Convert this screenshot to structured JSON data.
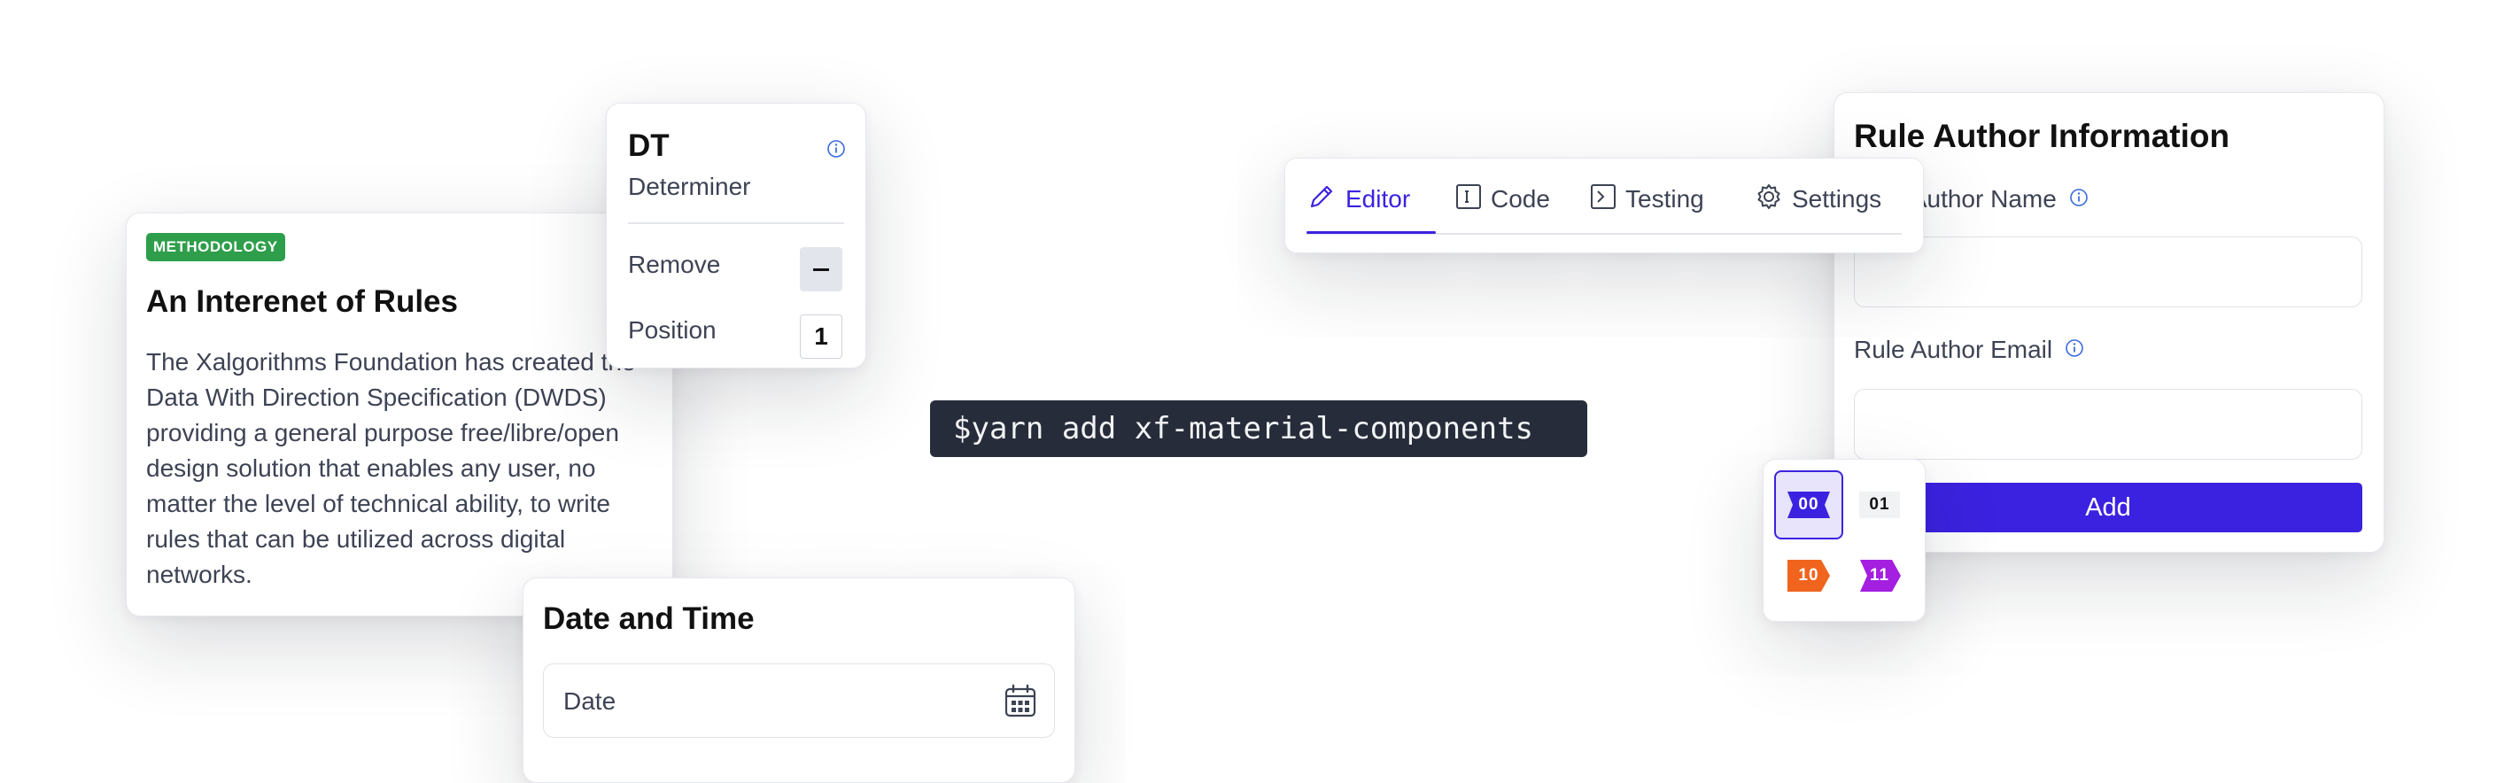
{
  "methodology_card": {
    "badge": "METHODOLOGY",
    "title": "An Interenet of Rules",
    "body": "The Xalgorithms Foundation has created the Data With Direction Specification (DWDS) providing a general purpose free/libre/open design solution that enables any user, no matter the level of technical ability, to write rules that can be utilized across digital networks."
  },
  "dt_card": {
    "title": "DT",
    "subtitle": "Determiner",
    "remove_label": "Remove",
    "position_label": "Position",
    "position_value": "1"
  },
  "datetime_card": {
    "title": "Date and Time",
    "date_placeholder": "Date"
  },
  "command": "$yarn add xf-material-components",
  "tabs": [
    {
      "label": "Editor",
      "icon": "pencil-icon",
      "active": true
    },
    {
      "label": "Code",
      "icon": "code-icon",
      "active": false
    },
    {
      "label": "Testing",
      "icon": "terminal-icon",
      "active": false
    },
    {
      "label": "Settings",
      "icon": "gear-icon",
      "active": false
    }
  ],
  "rule_author": {
    "title": "Rule Author Information",
    "name_label": "Rule Author Name",
    "email_label": "Rule Author Email",
    "name_value": "",
    "email_value": "",
    "add_label": "Add"
  },
  "tags": [
    {
      "code": "00",
      "selected": true,
      "color": "#3b22e0"
    },
    {
      "code": "01",
      "selected": false,
      "color": "#f1f2f4"
    },
    {
      "code": "10",
      "selected": false,
      "color": "#f0641e"
    },
    {
      "code": "11",
      "selected": false,
      "color": "#a41fe0"
    }
  ],
  "colors": {
    "accent": "#3b22e0",
    "badge_green": "#2e9e4a",
    "command_bg": "#272c3a"
  }
}
